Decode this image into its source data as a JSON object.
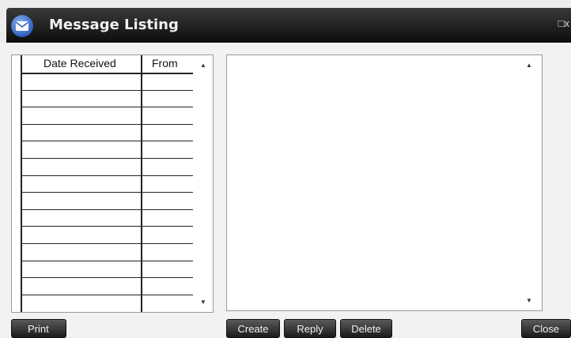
{
  "window": {
    "title": "Message Listing",
    "icon": "envelope-icon",
    "control": "□x"
  },
  "list": {
    "columns": [
      "Date Received",
      "From"
    ],
    "row_count": 13
  },
  "scroll": {
    "up": "▲",
    "down": "▼"
  },
  "buttons": {
    "print": "Print",
    "create": "Create",
    "reply": "Reply",
    "delete": "Delete",
    "close": "Close"
  }
}
